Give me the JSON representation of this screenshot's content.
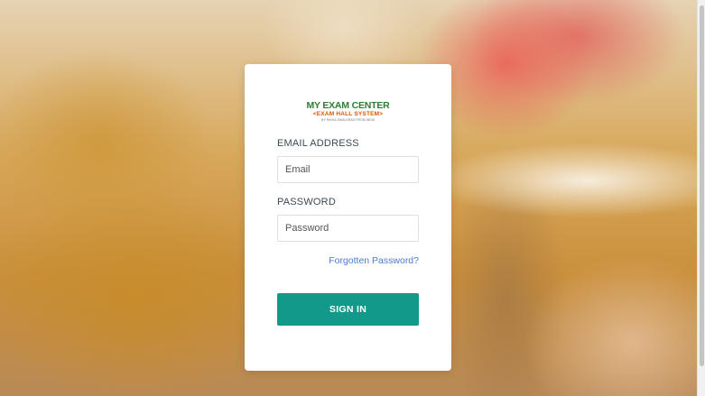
{
  "logo": {
    "title": "MY EXAM CENTER",
    "subtitle": "<EXAM HALL SYSTEM>",
    "tagline": "BY RAHUL BHALERAO FROM INDIA",
    "title_color": "#2e7d32",
    "subtitle_color": "#e65100"
  },
  "form": {
    "email_label": "EMAIL ADDRESS",
    "email_placeholder": "Email",
    "email_value": "",
    "password_label": "PASSWORD",
    "password_placeholder": "Password",
    "password_value": "",
    "forgot_label": "Forgotten Password?",
    "signin_label": "SIGN IN"
  },
  "colors": {
    "accent": "#12998a",
    "link": "#4a7bd0"
  }
}
